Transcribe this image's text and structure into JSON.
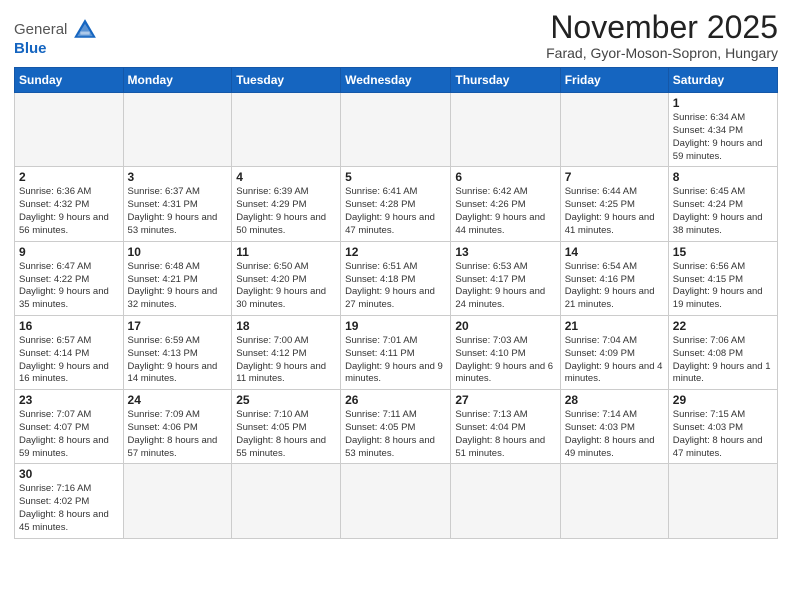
{
  "header": {
    "logo_general": "General",
    "logo_blue": "Blue",
    "month_title": "November 2025",
    "location": "Farad, Gyor-Moson-Sopron, Hungary"
  },
  "weekdays": [
    "Sunday",
    "Monday",
    "Tuesday",
    "Wednesday",
    "Thursday",
    "Friday",
    "Saturday"
  ],
  "weeks": [
    [
      null,
      null,
      null,
      null,
      null,
      null,
      {
        "day": "1",
        "sunrise": "Sunrise: 6:34 AM",
        "sunset": "Sunset: 4:34 PM",
        "daylight": "Daylight: 9 hours and 59 minutes."
      }
    ],
    [
      {
        "day": "2",
        "sunrise": "Sunrise: 6:36 AM",
        "sunset": "Sunset: 4:32 PM",
        "daylight": "Daylight: 9 hours and 56 minutes."
      },
      {
        "day": "3",
        "sunrise": "Sunrise: 6:37 AM",
        "sunset": "Sunset: 4:31 PM",
        "daylight": "Daylight: 9 hours and 53 minutes."
      },
      {
        "day": "4",
        "sunrise": "Sunrise: 6:39 AM",
        "sunset": "Sunset: 4:29 PM",
        "daylight": "Daylight: 9 hours and 50 minutes."
      },
      {
        "day": "5",
        "sunrise": "Sunrise: 6:41 AM",
        "sunset": "Sunset: 4:28 PM",
        "daylight": "Daylight: 9 hours and 47 minutes."
      },
      {
        "day": "6",
        "sunrise": "Sunrise: 6:42 AM",
        "sunset": "Sunset: 4:26 PM",
        "daylight": "Daylight: 9 hours and 44 minutes."
      },
      {
        "day": "7",
        "sunrise": "Sunrise: 6:44 AM",
        "sunset": "Sunset: 4:25 PM",
        "daylight": "Daylight: 9 hours and 41 minutes."
      },
      {
        "day": "8",
        "sunrise": "Sunrise: 6:45 AM",
        "sunset": "Sunset: 4:24 PM",
        "daylight": "Daylight: 9 hours and 38 minutes."
      }
    ],
    [
      {
        "day": "9",
        "sunrise": "Sunrise: 6:47 AM",
        "sunset": "Sunset: 4:22 PM",
        "daylight": "Daylight: 9 hours and 35 minutes."
      },
      {
        "day": "10",
        "sunrise": "Sunrise: 6:48 AM",
        "sunset": "Sunset: 4:21 PM",
        "daylight": "Daylight: 9 hours and 32 minutes."
      },
      {
        "day": "11",
        "sunrise": "Sunrise: 6:50 AM",
        "sunset": "Sunset: 4:20 PM",
        "daylight": "Daylight: 9 hours and 30 minutes."
      },
      {
        "day": "12",
        "sunrise": "Sunrise: 6:51 AM",
        "sunset": "Sunset: 4:18 PM",
        "daylight": "Daylight: 9 hours and 27 minutes."
      },
      {
        "day": "13",
        "sunrise": "Sunrise: 6:53 AM",
        "sunset": "Sunset: 4:17 PM",
        "daylight": "Daylight: 9 hours and 24 minutes."
      },
      {
        "day": "14",
        "sunrise": "Sunrise: 6:54 AM",
        "sunset": "Sunset: 4:16 PM",
        "daylight": "Daylight: 9 hours and 21 minutes."
      },
      {
        "day": "15",
        "sunrise": "Sunrise: 6:56 AM",
        "sunset": "Sunset: 4:15 PM",
        "daylight": "Daylight: 9 hours and 19 minutes."
      }
    ],
    [
      {
        "day": "16",
        "sunrise": "Sunrise: 6:57 AM",
        "sunset": "Sunset: 4:14 PM",
        "daylight": "Daylight: 9 hours and 16 minutes."
      },
      {
        "day": "17",
        "sunrise": "Sunrise: 6:59 AM",
        "sunset": "Sunset: 4:13 PM",
        "daylight": "Daylight: 9 hours and 14 minutes."
      },
      {
        "day": "18",
        "sunrise": "Sunrise: 7:00 AM",
        "sunset": "Sunset: 4:12 PM",
        "daylight": "Daylight: 9 hours and 11 minutes."
      },
      {
        "day": "19",
        "sunrise": "Sunrise: 7:01 AM",
        "sunset": "Sunset: 4:11 PM",
        "daylight": "Daylight: 9 hours and 9 minutes."
      },
      {
        "day": "20",
        "sunrise": "Sunrise: 7:03 AM",
        "sunset": "Sunset: 4:10 PM",
        "daylight": "Daylight: 9 hours and 6 minutes."
      },
      {
        "day": "21",
        "sunrise": "Sunrise: 7:04 AM",
        "sunset": "Sunset: 4:09 PM",
        "daylight": "Daylight: 9 hours and 4 minutes."
      },
      {
        "day": "22",
        "sunrise": "Sunrise: 7:06 AM",
        "sunset": "Sunset: 4:08 PM",
        "daylight": "Daylight: 9 hours and 1 minute."
      }
    ],
    [
      {
        "day": "23",
        "sunrise": "Sunrise: 7:07 AM",
        "sunset": "Sunset: 4:07 PM",
        "daylight": "Daylight: 8 hours and 59 minutes."
      },
      {
        "day": "24",
        "sunrise": "Sunrise: 7:09 AM",
        "sunset": "Sunset: 4:06 PM",
        "daylight": "Daylight: 8 hours and 57 minutes."
      },
      {
        "day": "25",
        "sunrise": "Sunrise: 7:10 AM",
        "sunset": "Sunset: 4:05 PM",
        "daylight": "Daylight: 8 hours and 55 minutes."
      },
      {
        "day": "26",
        "sunrise": "Sunrise: 7:11 AM",
        "sunset": "Sunset: 4:05 PM",
        "daylight": "Daylight: 8 hours and 53 minutes."
      },
      {
        "day": "27",
        "sunrise": "Sunrise: 7:13 AM",
        "sunset": "Sunset: 4:04 PM",
        "daylight": "Daylight: 8 hours and 51 minutes."
      },
      {
        "day": "28",
        "sunrise": "Sunrise: 7:14 AM",
        "sunset": "Sunset: 4:03 PM",
        "daylight": "Daylight: 8 hours and 49 minutes."
      },
      {
        "day": "29",
        "sunrise": "Sunrise: 7:15 AM",
        "sunset": "Sunset: 4:03 PM",
        "daylight": "Daylight: 8 hours and 47 minutes."
      }
    ],
    [
      {
        "day": "30",
        "sunrise": "Sunrise: 7:16 AM",
        "sunset": "Sunset: 4:02 PM",
        "daylight": "Daylight: 8 hours and 45 minutes."
      },
      null,
      null,
      null,
      null,
      null,
      null
    ]
  ]
}
